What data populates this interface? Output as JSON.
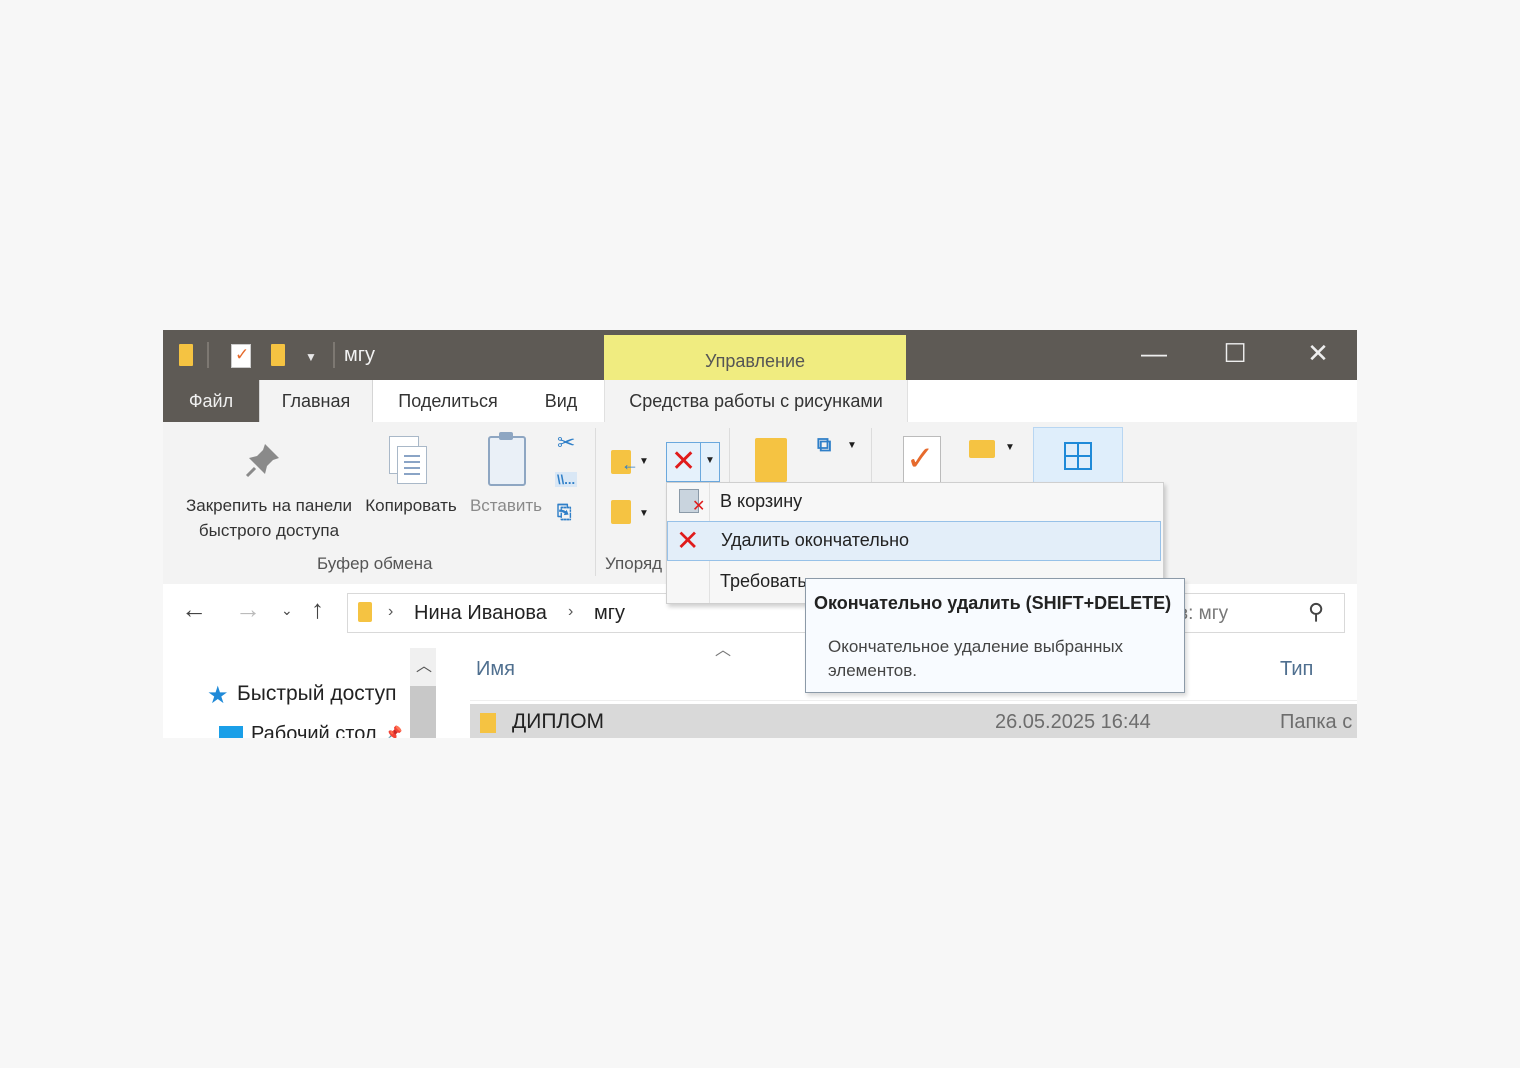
{
  "window": {
    "title": "мгу",
    "context_band": "Управление",
    "controls": {
      "minimize": "—",
      "maximize": "☐",
      "close": "✕"
    }
  },
  "tabs": {
    "file": "Файл",
    "home": "Главная",
    "share": "Поделиться",
    "view": "Вид",
    "picture_tools": "Средства работы с рисунками",
    "help": "?"
  },
  "ribbon": {
    "pin_label_1": "Закрепить на панели",
    "pin_label_2": "быстрого доступа",
    "copy": "Копировать",
    "paste": "Вставить",
    "group_clipboard": "Буфер обмена",
    "group_organize": "Упоряд"
  },
  "delete_menu": {
    "items": [
      {
        "label": "В корзину",
        "icon": "recycle-bin-icon"
      },
      {
        "label": "Удалить окончательно",
        "icon": "delete-x-icon",
        "highlighted": true
      },
      {
        "label": "Требовать",
        "icon": ""
      }
    ]
  },
  "tooltip": {
    "title": "Окончательно удалить (SHIFT+DELETE)",
    "body": "Окончательное удаление выбранных элементов."
  },
  "address": {
    "crumbs": [
      "Нина Иванова",
      "мгу"
    ],
    "search_placeholder": "в: мгу"
  },
  "nav_pane": {
    "quick_access": "Быстрый доступ",
    "desktop": "Рабочий стол"
  },
  "files": {
    "columns": {
      "name": "Имя",
      "type": "Тип"
    },
    "rows": [
      {
        "name": "ДИПЛОМ",
        "date": "26.05.2025 16:44",
        "type": "Папка с"
      }
    ]
  },
  "colors": {
    "titlebar": "#5e5a55",
    "context_band": "#f0ec80",
    "delete_red": "#e01b1b",
    "accent_blue": "#1f7bd6"
  }
}
